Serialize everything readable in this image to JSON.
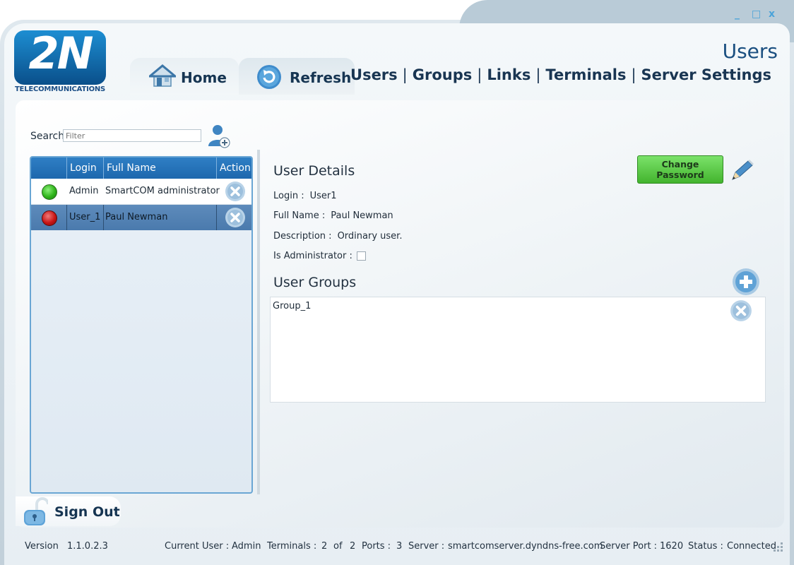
{
  "window": {
    "minimize": "_",
    "maximize": "□",
    "close": "x"
  },
  "logo": {
    "mark": "2N",
    "subtitle": "TELECOMMUNICATIONS"
  },
  "tabs": {
    "home": "Home",
    "refresh": "Refresh"
  },
  "header": {
    "title": "Users",
    "nav": [
      "Users",
      "Groups",
      "Links",
      "Terminals",
      "Server Settings"
    ]
  },
  "search": {
    "label": "Search",
    "placeholder": "Filter",
    "value": ""
  },
  "users_grid": {
    "columns": [
      "Login",
      "Full Name",
      "Action"
    ],
    "rows": [
      {
        "login": "Admin",
        "full_name": "SmartCOM administrator",
        "status": "online"
      },
      {
        "login": "User_1",
        "full_name": "Paul Newman",
        "status": "offline"
      }
    ]
  },
  "details": {
    "title": "User Details",
    "change_password": "Change Password",
    "login_label": "Login :",
    "login_value": "User1",
    "full_name_label": "Full Name :",
    "full_name_value": "Paul Newman",
    "description_label": "Description :",
    "description_value": "Ordinary user.",
    "is_admin_label": "Is Administrator :",
    "is_admin": false
  },
  "groups": {
    "title": "User Groups",
    "items": [
      "Group_1"
    ]
  },
  "signout": {
    "label": "Sign Out"
  },
  "status_bar": {
    "version_label": "Version",
    "version": "1.1.0.2.3",
    "current_user_label": "Current User :",
    "current_user": "Admin",
    "terminals_label": "Terminals :",
    "terminals_count": "2",
    "terminals_of": "of",
    "terminals_total": "2",
    "ports_label": "Ports :",
    "ports": "3",
    "server_label": "Server :",
    "server": "smartcomserver.dyndns-free.com",
    "server_port_label": "Server Port :",
    "server_port": "1620",
    "status_label": "Status :",
    "status": "Connected"
  },
  "colors": {
    "accent_blue": "#1d67ad",
    "change_password_green": "#43b42e",
    "status_online": "#2fb41a",
    "status_offline": "#c81515"
  },
  "icons": [
    "home-icon",
    "refresh-icon",
    "add-user-icon",
    "delete-icon",
    "pencil-icon",
    "add-icon",
    "lock-icon",
    "resize-grip-icon"
  ]
}
